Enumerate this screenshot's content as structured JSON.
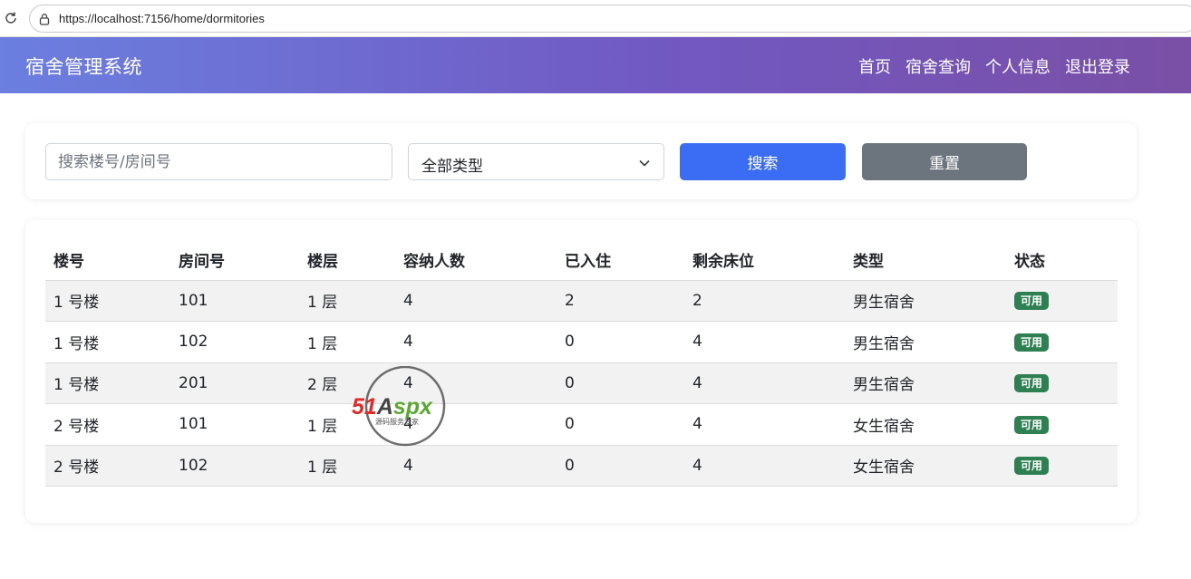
{
  "browser": {
    "url": "https://localhost:7156/home/dormitories"
  },
  "header": {
    "brand": "宿舍管理系统",
    "nav": [
      {
        "label": "首页"
      },
      {
        "label": "宿舍查询"
      },
      {
        "label": "个人信息"
      },
      {
        "label": "退出登录"
      }
    ]
  },
  "search": {
    "placeholder": "搜索楼号/房间号",
    "type_select_value": "全部类型",
    "search_label": "搜索",
    "reset_label": "重置"
  },
  "table": {
    "headers": [
      "楼号",
      "房间号",
      "楼层",
      "容纳人数",
      "已入住",
      "剩余床位",
      "类型",
      "状态"
    ],
    "rows": [
      {
        "building": "1 号楼",
        "room": "101",
        "floor": "1 层",
        "capacity": "4",
        "occupied": "2",
        "remaining": "2",
        "type": "男生宿舍",
        "status": "可用"
      },
      {
        "building": "1 号楼",
        "room": "102",
        "floor": "1 层",
        "capacity": "4",
        "occupied": "0",
        "remaining": "4",
        "type": "男生宿舍",
        "status": "可用"
      },
      {
        "building": "1 号楼",
        "room": "201",
        "floor": "2 层",
        "capacity": "4",
        "occupied": "0",
        "remaining": "4",
        "type": "男生宿舍",
        "status": "可用"
      },
      {
        "building": "2 号楼",
        "room": "101",
        "floor": "1 层",
        "capacity": "4",
        "occupied": "0",
        "remaining": "4",
        "type": "女生宿舍",
        "status": "可用"
      },
      {
        "building": "2 号楼",
        "room": "102",
        "floor": "1 层",
        "capacity": "4",
        "occupied": "0",
        "remaining": "4",
        "type": "女生宿舍",
        "status": "可用"
      }
    ]
  },
  "watermark": {
    "logo_text": "51Aspx",
    "tagline": "源码服务专家"
  },
  "colors": {
    "header_gradient_start": "#6b7fe0",
    "header_gradient_end": "#7a4fa6",
    "search_button": "#3a6cf4",
    "reset_button": "#6c757d",
    "status_badge": "#2e8052"
  }
}
